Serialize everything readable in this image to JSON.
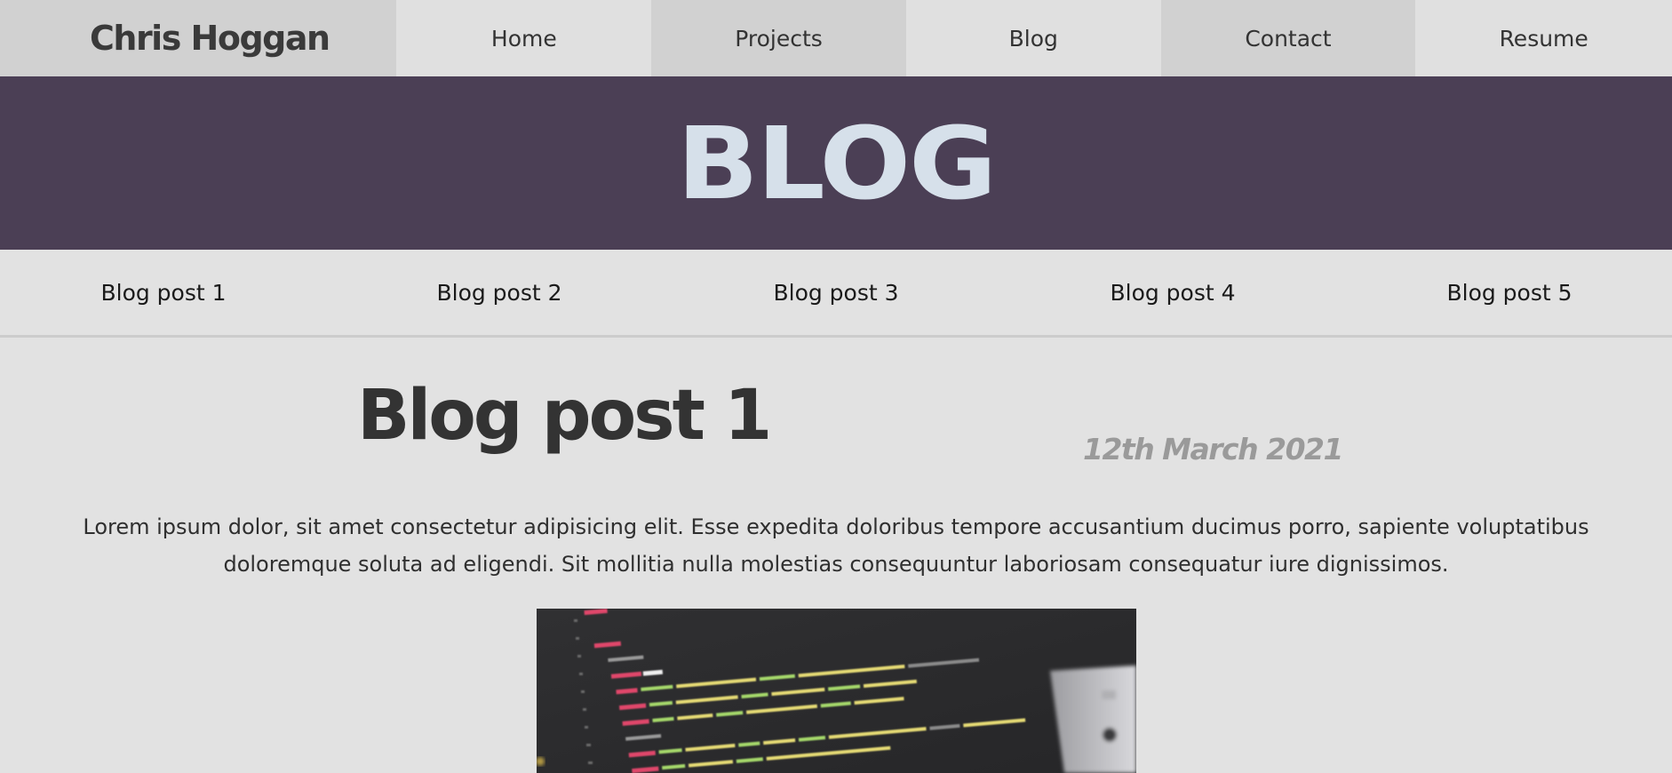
{
  "brand": "Chris Hoggan",
  "nav": {
    "items": [
      {
        "label": "Home"
      },
      {
        "label": "Projects"
      },
      {
        "label": "Blog"
      },
      {
        "label": "Contact"
      },
      {
        "label": "Resume"
      }
    ]
  },
  "hero": {
    "title": "BLOG"
  },
  "post_tabs": [
    {
      "label": "Blog post 1"
    },
    {
      "label": "Blog post 2"
    },
    {
      "label": "Blog post 3"
    },
    {
      "label": "Blog post 4"
    },
    {
      "label": "Blog post 5"
    }
  ],
  "post": {
    "title": "Blog post 1",
    "date": "12th March 2021",
    "body": "Lorem ipsum dolor, sit amet consectetur adipisicing elit. Esse expedita doloribus tempore accusantium ducimus porro, sapiente voluptatibus doloremque soluta ad eligendi. Sit mollitia nulla molestias consequuntur laboriosam consequatur iure dignissimos."
  },
  "colors": {
    "hero_bg": "#4b3f55",
    "hero_text": "#d6e0ea",
    "page_bg": "#e2e2e2",
    "nav_dark": "#d1d1d1",
    "nav_light": "#e0e0e0",
    "date_text": "#9a9a9a"
  }
}
